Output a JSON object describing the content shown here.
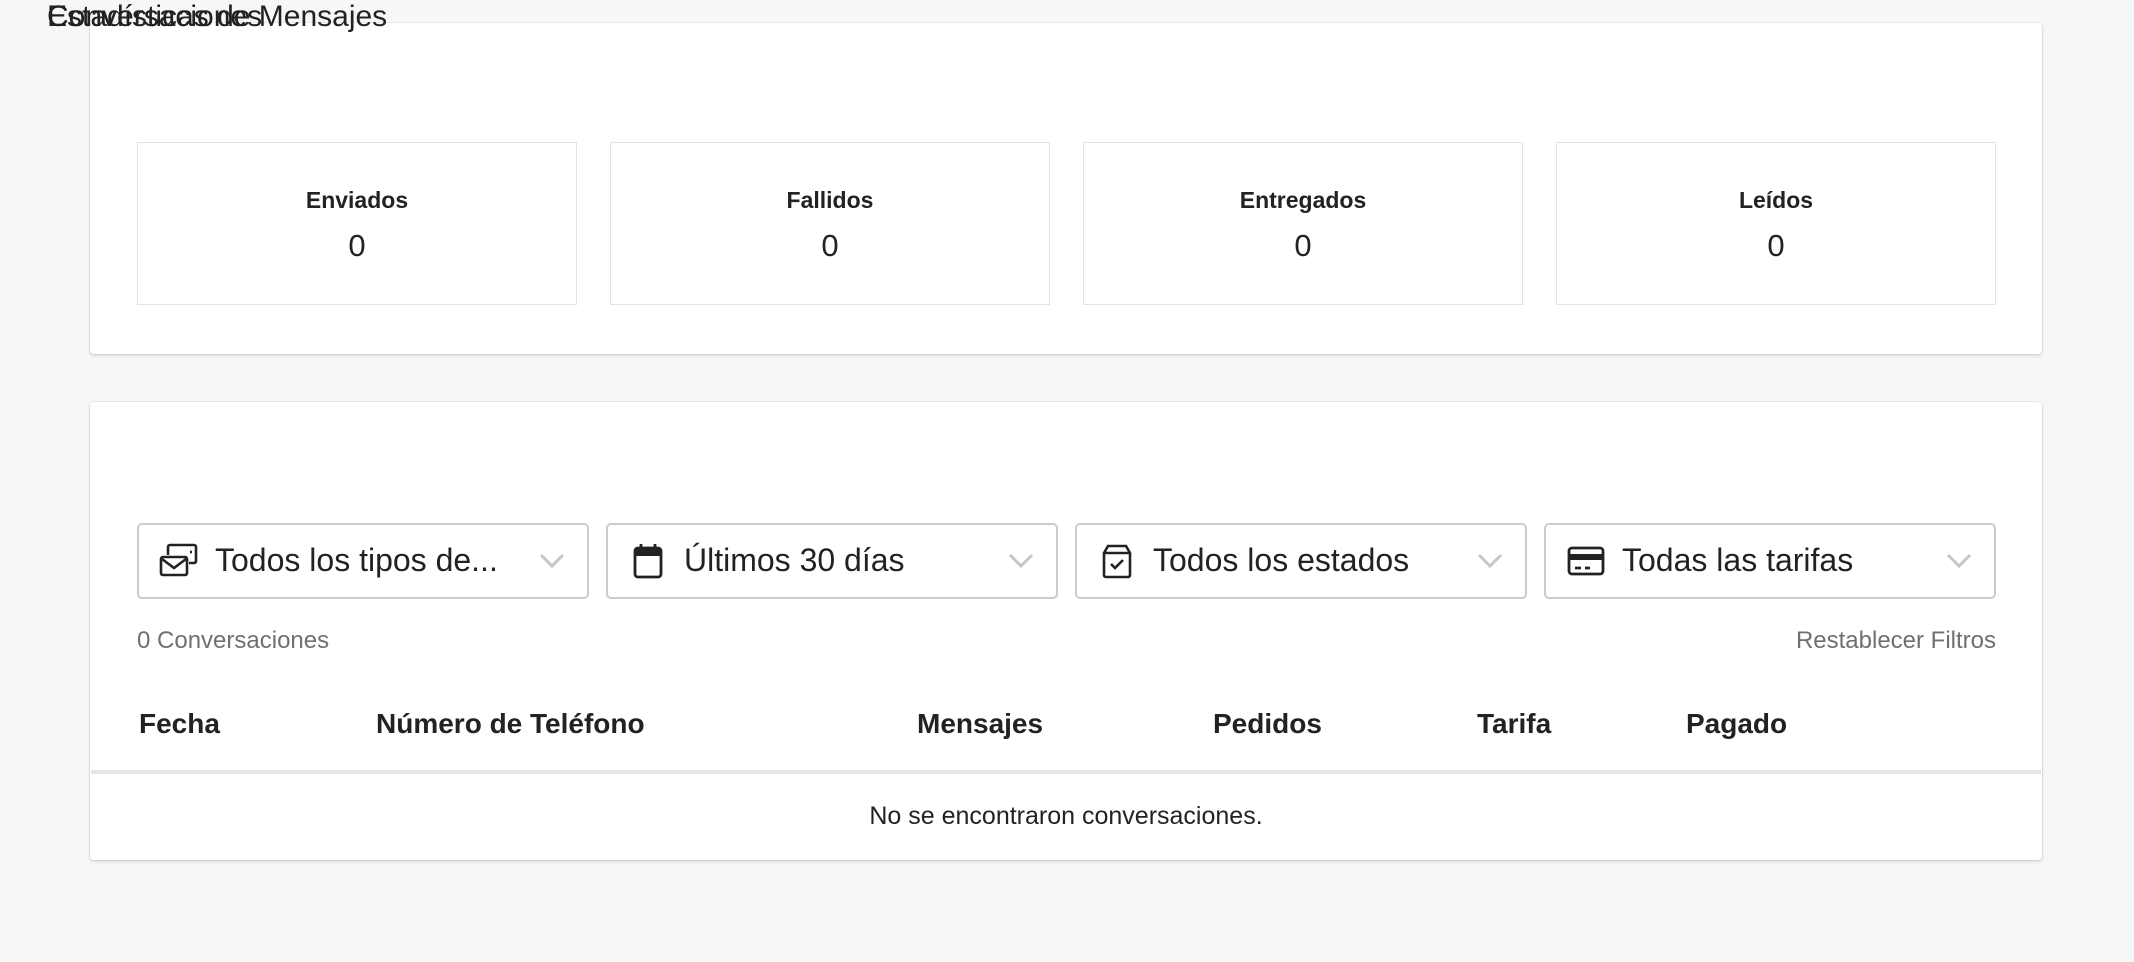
{
  "stats": {
    "title": "Estadísticas de Mensajes",
    "items": [
      {
        "label": "Enviados",
        "value": "0"
      },
      {
        "label": "Fallidos",
        "value": "0"
      },
      {
        "label": "Entregados",
        "value": "0"
      },
      {
        "label": "Leídos",
        "value": "0"
      }
    ]
  },
  "conversations": {
    "title": "Conversaciones",
    "filters": [
      {
        "icon": "message-types-icon",
        "value": "Todos los tipos de..."
      },
      {
        "icon": "calendar-icon",
        "value": "Últimos 30 días"
      },
      {
        "icon": "status-box-icon",
        "value": "Todos los estados"
      },
      {
        "icon": "credit-card-icon",
        "value": "Todas las tarifas"
      }
    ],
    "count_label": "0 Conversaciones",
    "reset_label": "Restablecer Filtros",
    "columns": [
      "Fecha",
      "Número de Teléfono",
      "Mensajes",
      "Pedidos",
      "Tarifa",
      "Pagado"
    ],
    "empty_message": "No se encontraron conversaciones."
  }
}
